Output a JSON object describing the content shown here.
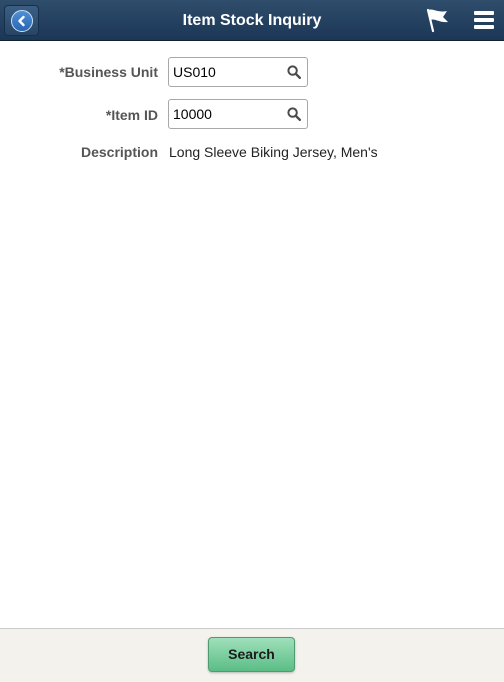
{
  "header": {
    "title": "Item Stock Inquiry",
    "back_icon": "back-arrow-icon",
    "flag_icon": "flag-icon",
    "menu_icon": "hamburger-menu-icon",
    "background_color": "#1f3a5b"
  },
  "form": {
    "business_unit": {
      "label": "*Business Unit",
      "value": "US010",
      "lookup_icon": "search-icon"
    },
    "item_id": {
      "label": "*Item ID",
      "value": "10000",
      "lookup_icon": "search-icon"
    },
    "description": {
      "label": "Description",
      "value": "Long Sleeve Biking Jersey, Men's"
    }
  },
  "footer": {
    "search_label": "Search",
    "button_color": "#5bbd86"
  }
}
